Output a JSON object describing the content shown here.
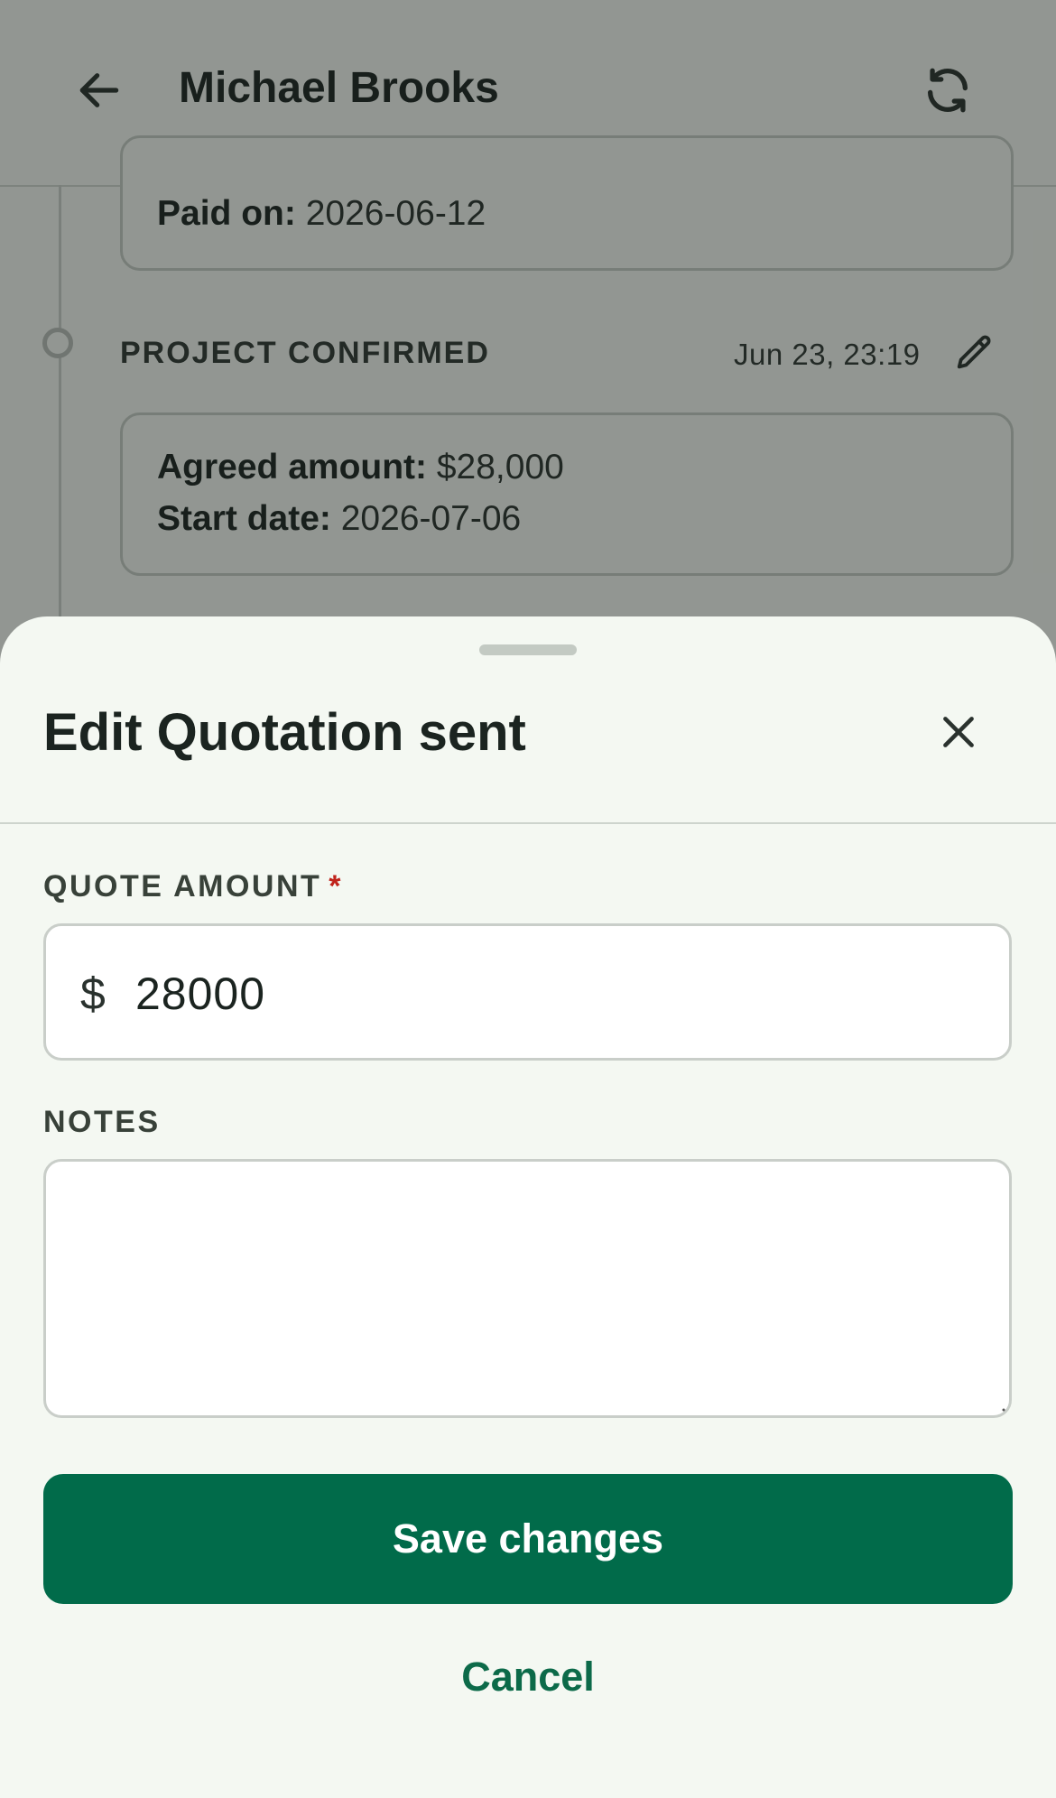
{
  "header": {
    "title": "Michael Brooks",
    "back_icon": "arrow-left-icon",
    "refresh_icon": "refresh-icon"
  },
  "timeline": {
    "paid_card": {
      "label": "Paid on:",
      "value": "2026-06-12"
    },
    "event": {
      "title": "PROJECT CONFIRMED",
      "time": "Jun 23, 23:19",
      "edit_icon": "pencil-icon"
    },
    "confirmed_card": {
      "amount_label": "Agreed amount:",
      "amount_value": "$28,000",
      "start_label": "Start date:",
      "start_value": "2026-07-06"
    }
  },
  "sheet": {
    "title": "Edit Quotation sent",
    "close_icon": "close-icon",
    "quote_label": "QUOTE AMOUNT",
    "required_mark": "*",
    "currency_symbol": "$",
    "quote_value": "28000",
    "notes_label": "NOTES",
    "notes_value": "",
    "save_label": "Save changes",
    "cancel_label": "Cancel"
  },
  "colors": {
    "primary": "#016b4a",
    "background": "#f4f8f2",
    "required": "#c0231b"
  }
}
